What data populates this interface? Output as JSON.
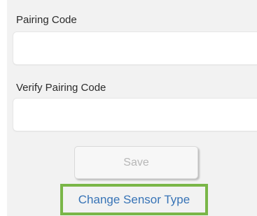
{
  "form": {
    "pairing_code_label": "Pairing Code",
    "pairing_code_value": "",
    "verify_pairing_code_label": "Verify Pairing Code",
    "verify_pairing_code_value": ""
  },
  "actions": {
    "save_label": "Save",
    "change_sensor_type_label": "Change Sensor Type"
  },
  "colors": {
    "panel_background": "#f2f2f2",
    "link_text": "#3773b6",
    "highlight_border": "#7ab648",
    "disabled_text": "#b7b7b7"
  }
}
